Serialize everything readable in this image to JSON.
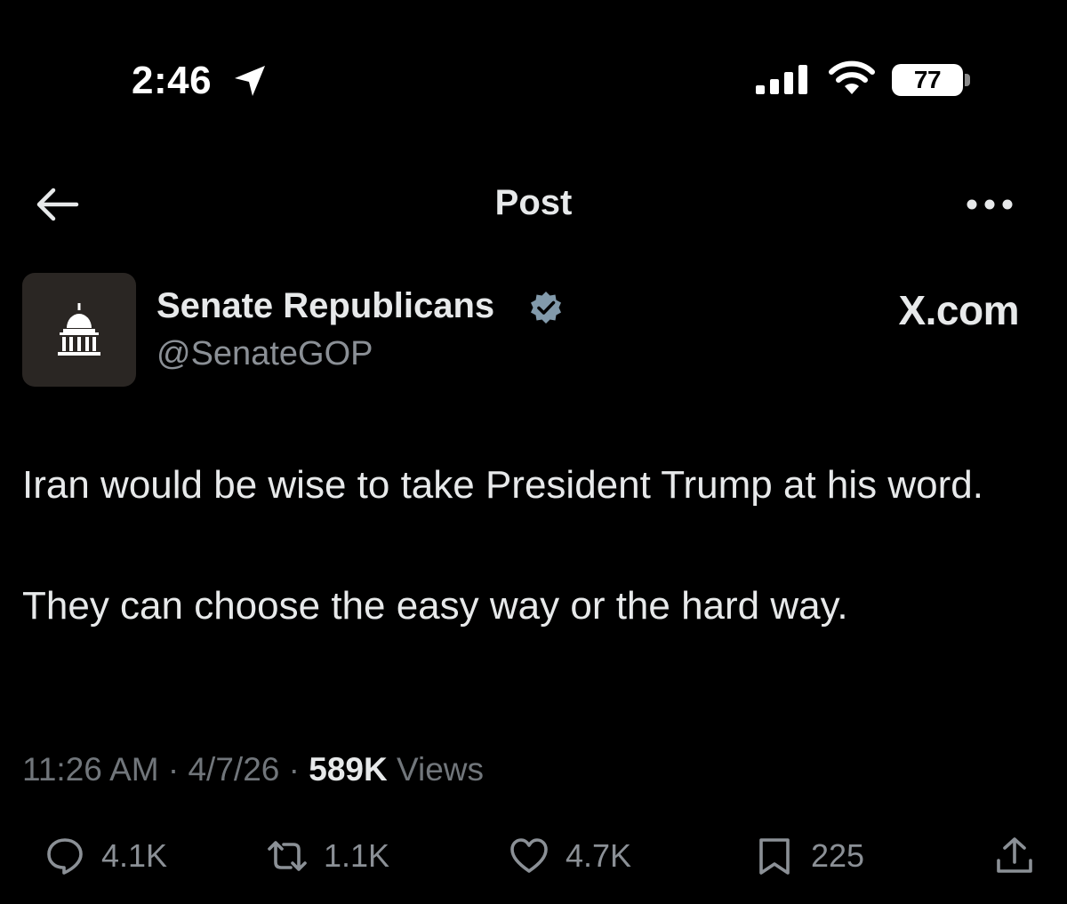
{
  "status_bar": {
    "time": "2:46",
    "battery": "77"
  },
  "header": {
    "title": "Post",
    "icons": [
      "back-arrow-icon",
      "more-options-icon"
    ]
  },
  "author": {
    "name": "Senate Republicans",
    "handle": "@SenateGOP",
    "verified": true,
    "verified_color": "#829aab"
  },
  "watermark": "X.com",
  "post": {
    "paragraphs": [
      "Iran would be wise to take President Trump at his word.",
      "They can choose the easy way or the hard way."
    ],
    "time": "11:26 AM",
    "date": "4/7/26",
    "separator": "·",
    "views_count": "589K",
    "views_label": "Views"
  },
  "actions": {
    "replies": "4.1K",
    "reposts": "1.1K",
    "likes": "4.7K",
    "bookmarks": "225"
  },
  "colors": {
    "background": "#000000",
    "primary_text": "#e7e9ea",
    "secondary_text": "#71767b"
  }
}
